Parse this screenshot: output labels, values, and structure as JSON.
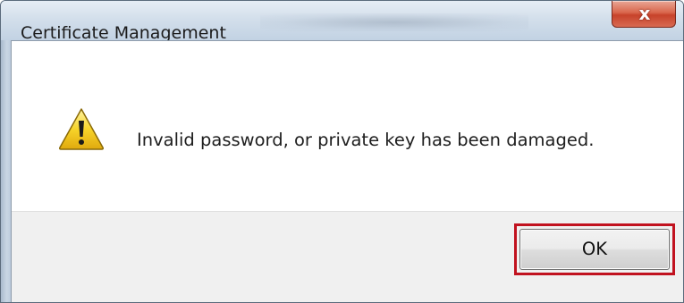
{
  "window": {
    "title": "Certificate Management",
    "close_glyph": "x"
  },
  "dialog": {
    "icon": "warning-icon",
    "message": "Invalid password, or private key has been damaged.",
    "ok_label": "OK"
  },
  "colors": {
    "highlight_border": "#c1121f",
    "close_button": "#c7422a",
    "button_area": "#f0f0f0",
    "warning_fill": "#f5d020"
  }
}
